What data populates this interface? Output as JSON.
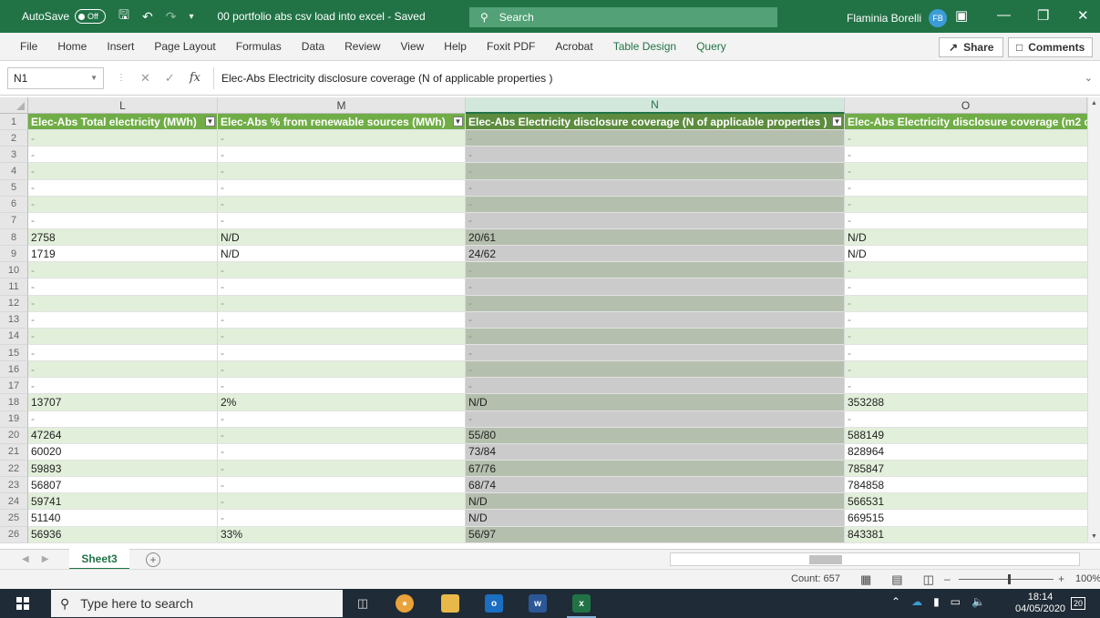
{
  "titlebar": {
    "autosave_label": "AutoSave",
    "autosave_state": "Off",
    "doc_title": "00 portfolio abs csv load into excel - Saved",
    "search_placeholder": "Search",
    "user_name": "Flaminia Borelli",
    "user_initials": "FB"
  },
  "ribbon": {
    "tabs": [
      "File",
      "Home",
      "Insert",
      "Page Layout",
      "Formulas",
      "Data",
      "Review",
      "View",
      "Help",
      "Foxit PDF",
      "Acrobat",
      "Table Design",
      "Query"
    ],
    "share_label": "Share",
    "comments_label": "Comments"
  },
  "formula_bar": {
    "name_box": "N1",
    "formula": "Elec-Abs Electricity disclosure coverage (N of applicable properties )"
  },
  "grid": {
    "columns": [
      "L",
      "M",
      "N",
      "O"
    ],
    "selected_column": "N",
    "headers": [
      "Elec-Abs Total electricity (MWh)",
      "Elec-Abs % from renewable sources (MWh)",
      "Elec-Abs Electricity disclosure coverage (N of applicable properties )",
      "Elec-Abs Electricity disclosure coverage (m2 of"
    ],
    "rows": [
      {
        "n": "2",
        "L": "-",
        "M": "-",
        "N": "-",
        "O": "-"
      },
      {
        "n": "3",
        "L": "-",
        "M": "-",
        "N": "-",
        "O": "-"
      },
      {
        "n": "4",
        "L": "-",
        "M": "-",
        "N": "-",
        "O": "-"
      },
      {
        "n": "5",
        "L": "-",
        "M": "-",
        "N": "-",
        "O": "-"
      },
      {
        "n": "6",
        "L": "-",
        "M": "-",
        "N": "-",
        "O": "-"
      },
      {
        "n": "7",
        "L": "-",
        "M": "-",
        "N": "-",
        "O": "-"
      },
      {
        "n": "8",
        "L": "2758",
        "M": "N/D",
        "N": "20/61",
        "O": "N/D"
      },
      {
        "n": "9",
        "L": "1719",
        "M": "N/D",
        "N": "24/62",
        "O": "N/D"
      },
      {
        "n": "10",
        "L": "-",
        "M": "-",
        "N": "-",
        "O": "-"
      },
      {
        "n": "11",
        "L": "-",
        "M": "-",
        "N": "-",
        "O": "-"
      },
      {
        "n": "12",
        "L": "-",
        "M": "-",
        "N": "-",
        "O": "-"
      },
      {
        "n": "13",
        "L": "-",
        "M": "-",
        "N": "-",
        "O": "-"
      },
      {
        "n": "14",
        "L": "-",
        "M": "-",
        "N": "-",
        "O": "-"
      },
      {
        "n": "15",
        "L": "-",
        "M": "-",
        "N": "-",
        "O": "-"
      },
      {
        "n": "16",
        "L": "-",
        "M": "-",
        "N": "-",
        "O": "-"
      },
      {
        "n": "17",
        "L": "-",
        "M": "-",
        "N": "-",
        "O": "-"
      },
      {
        "n": "18",
        "L": "13707",
        "M": "2%",
        "N": "N/D",
        "O": "353288"
      },
      {
        "n": "19",
        "L": "-",
        "M": "-",
        "N": "-",
        "O": "-"
      },
      {
        "n": "20",
        "L": "47264",
        "M": "-",
        "N": "55/80",
        "O": "588149"
      },
      {
        "n": "21",
        "L": "60020",
        "M": "-",
        "N": "73/84",
        "O": "828964"
      },
      {
        "n": "22",
        "L": "59893",
        "M": "-",
        "N": "67/76",
        "O": "785847"
      },
      {
        "n": "23",
        "L": "56807",
        "M": "-",
        "N": "68/74",
        "O": "784858"
      },
      {
        "n": "24",
        "L": "59741",
        "M": "-",
        "N": "N/D",
        "O": "566531"
      },
      {
        "n": "25",
        "L": "51140",
        "M": "-",
        "N": "N/D",
        "O": "669515"
      },
      {
        "n": "26",
        "L": "56936",
        "M": "33%",
        "N": "56/97",
        "O": "843381"
      }
    ]
  },
  "sheets": {
    "active": "Sheet3"
  },
  "status": {
    "count": "Count: 657",
    "zoom": "100%"
  },
  "taskbar": {
    "search_placeholder": "Type here to search",
    "time": "18:14",
    "date": "04/05/2020",
    "notifications": "20"
  },
  "colors": {
    "excel_green": "#217346",
    "table_header": "#70ad47",
    "band": "#e2efda"
  }
}
